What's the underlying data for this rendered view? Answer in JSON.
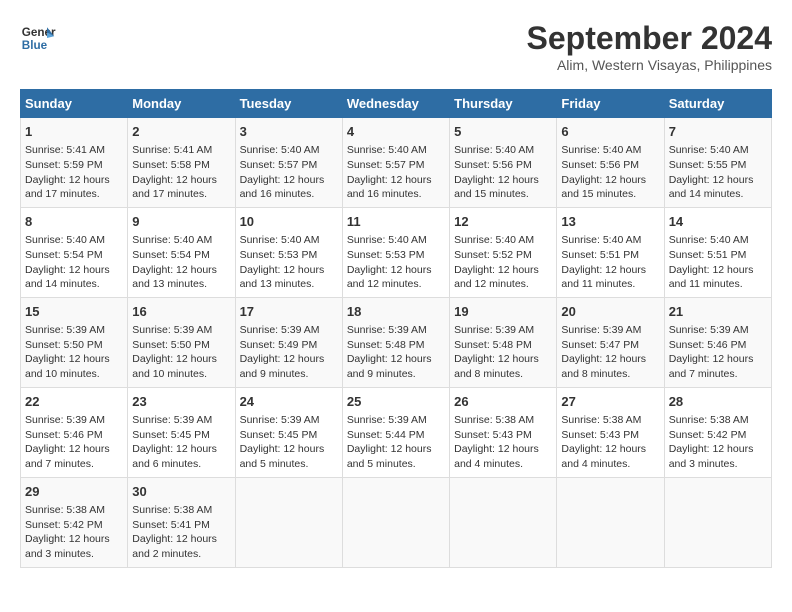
{
  "header": {
    "logo_line1": "General",
    "logo_line2": "Blue",
    "month": "September 2024",
    "location": "Alim, Western Visayas, Philippines"
  },
  "days_of_week": [
    "Sunday",
    "Monday",
    "Tuesday",
    "Wednesday",
    "Thursday",
    "Friday",
    "Saturday"
  ],
  "weeks": [
    [
      {
        "day": "1",
        "info": "Sunrise: 5:41 AM\nSunset: 5:59 PM\nDaylight: 12 hours\nand 17 minutes."
      },
      {
        "day": "2",
        "info": "Sunrise: 5:41 AM\nSunset: 5:58 PM\nDaylight: 12 hours\nand 17 minutes."
      },
      {
        "day": "3",
        "info": "Sunrise: 5:40 AM\nSunset: 5:57 PM\nDaylight: 12 hours\nand 16 minutes."
      },
      {
        "day": "4",
        "info": "Sunrise: 5:40 AM\nSunset: 5:57 PM\nDaylight: 12 hours\nand 16 minutes."
      },
      {
        "day": "5",
        "info": "Sunrise: 5:40 AM\nSunset: 5:56 PM\nDaylight: 12 hours\nand 15 minutes."
      },
      {
        "day": "6",
        "info": "Sunrise: 5:40 AM\nSunset: 5:56 PM\nDaylight: 12 hours\nand 15 minutes."
      },
      {
        "day": "7",
        "info": "Sunrise: 5:40 AM\nSunset: 5:55 PM\nDaylight: 12 hours\nand 14 minutes."
      }
    ],
    [
      {
        "day": "8",
        "info": "Sunrise: 5:40 AM\nSunset: 5:54 PM\nDaylight: 12 hours\nand 14 minutes."
      },
      {
        "day": "9",
        "info": "Sunrise: 5:40 AM\nSunset: 5:54 PM\nDaylight: 12 hours\nand 13 minutes."
      },
      {
        "day": "10",
        "info": "Sunrise: 5:40 AM\nSunset: 5:53 PM\nDaylight: 12 hours\nand 13 minutes."
      },
      {
        "day": "11",
        "info": "Sunrise: 5:40 AM\nSunset: 5:53 PM\nDaylight: 12 hours\nand 12 minutes."
      },
      {
        "day": "12",
        "info": "Sunrise: 5:40 AM\nSunset: 5:52 PM\nDaylight: 12 hours\nand 12 minutes."
      },
      {
        "day": "13",
        "info": "Sunrise: 5:40 AM\nSunset: 5:51 PM\nDaylight: 12 hours\nand 11 minutes."
      },
      {
        "day": "14",
        "info": "Sunrise: 5:40 AM\nSunset: 5:51 PM\nDaylight: 12 hours\nand 11 minutes."
      }
    ],
    [
      {
        "day": "15",
        "info": "Sunrise: 5:39 AM\nSunset: 5:50 PM\nDaylight: 12 hours\nand 10 minutes."
      },
      {
        "day": "16",
        "info": "Sunrise: 5:39 AM\nSunset: 5:50 PM\nDaylight: 12 hours\nand 10 minutes."
      },
      {
        "day": "17",
        "info": "Sunrise: 5:39 AM\nSunset: 5:49 PM\nDaylight: 12 hours\nand 9 minutes."
      },
      {
        "day": "18",
        "info": "Sunrise: 5:39 AM\nSunset: 5:48 PM\nDaylight: 12 hours\nand 9 minutes."
      },
      {
        "day": "19",
        "info": "Sunrise: 5:39 AM\nSunset: 5:48 PM\nDaylight: 12 hours\nand 8 minutes."
      },
      {
        "day": "20",
        "info": "Sunrise: 5:39 AM\nSunset: 5:47 PM\nDaylight: 12 hours\nand 8 minutes."
      },
      {
        "day": "21",
        "info": "Sunrise: 5:39 AM\nSunset: 5:46 PM\nDaylight: 12 hours\nand 7 minutes."
      }
    ],
    [
      {
        "day": "22",
        "info": "Sunrise: 5:39 AM\nSunset: 5:46 PM\nDaylight: 12 hours\nand 7 minutes."
      },
      {
        "day": "23",
        "info": "Sunrise: 5:39 AM\nSunset: 5:45 PM\nDaylight: 12 hours\nand 6 minutes."
      },
      {
        "day": "24",
        "info": "Sunrise: 5:39 AM\nSunset: 5:45 PM\nDaylight: 12 hours\nand 5 minutes."
      },
      {
        "day": "25",
        "info": "Sunrise: 5:39 AM\nSunset: 5:44 PM\nDaylight: 12 hours\nand 5 minutes."
      },
      {
        "day": "26",
        "info": "Sunrise: 5:38 AM\nSunset: 5:43 PM\nDaylight: 12 hours\nand 4 minutes."
      },
      {
        "day": "27",
        "info": "Sunrise: 5:38 AM\nSunset: 5:43 PM\nDaylight: 12 hours\nand 4 minutes."
      },
      {
        "day": "28",
        "info": "Sunrise: 5:38 AM\nSunset: 5:42 PM\nDaylight: 12 hours\nand 3 minutes."
      }
    ],
    [
      {
        "day": "29",
        "info": "Sunrise: 5:38 AM\nSunset: 5:42 PM\nDaylight: 12 hours\nand 3 minutes."
      },
      {
        "day": "30",
        "info": "Sunrise: 5:38 AM\nSunset: 5:41 PM\nDaylight: 12 hours\nand 2 minutes."
      },
      {
        "day": "",
        "info": ""
      },
      {
        "day": "",
        "info": ""
      },
      {
        "day": "",
        "info": ""
      },
      {
        "day": "",
        "info": ""
      },
      {
        "day": "",
        "info": ""
      }
    ]
  ]
}
